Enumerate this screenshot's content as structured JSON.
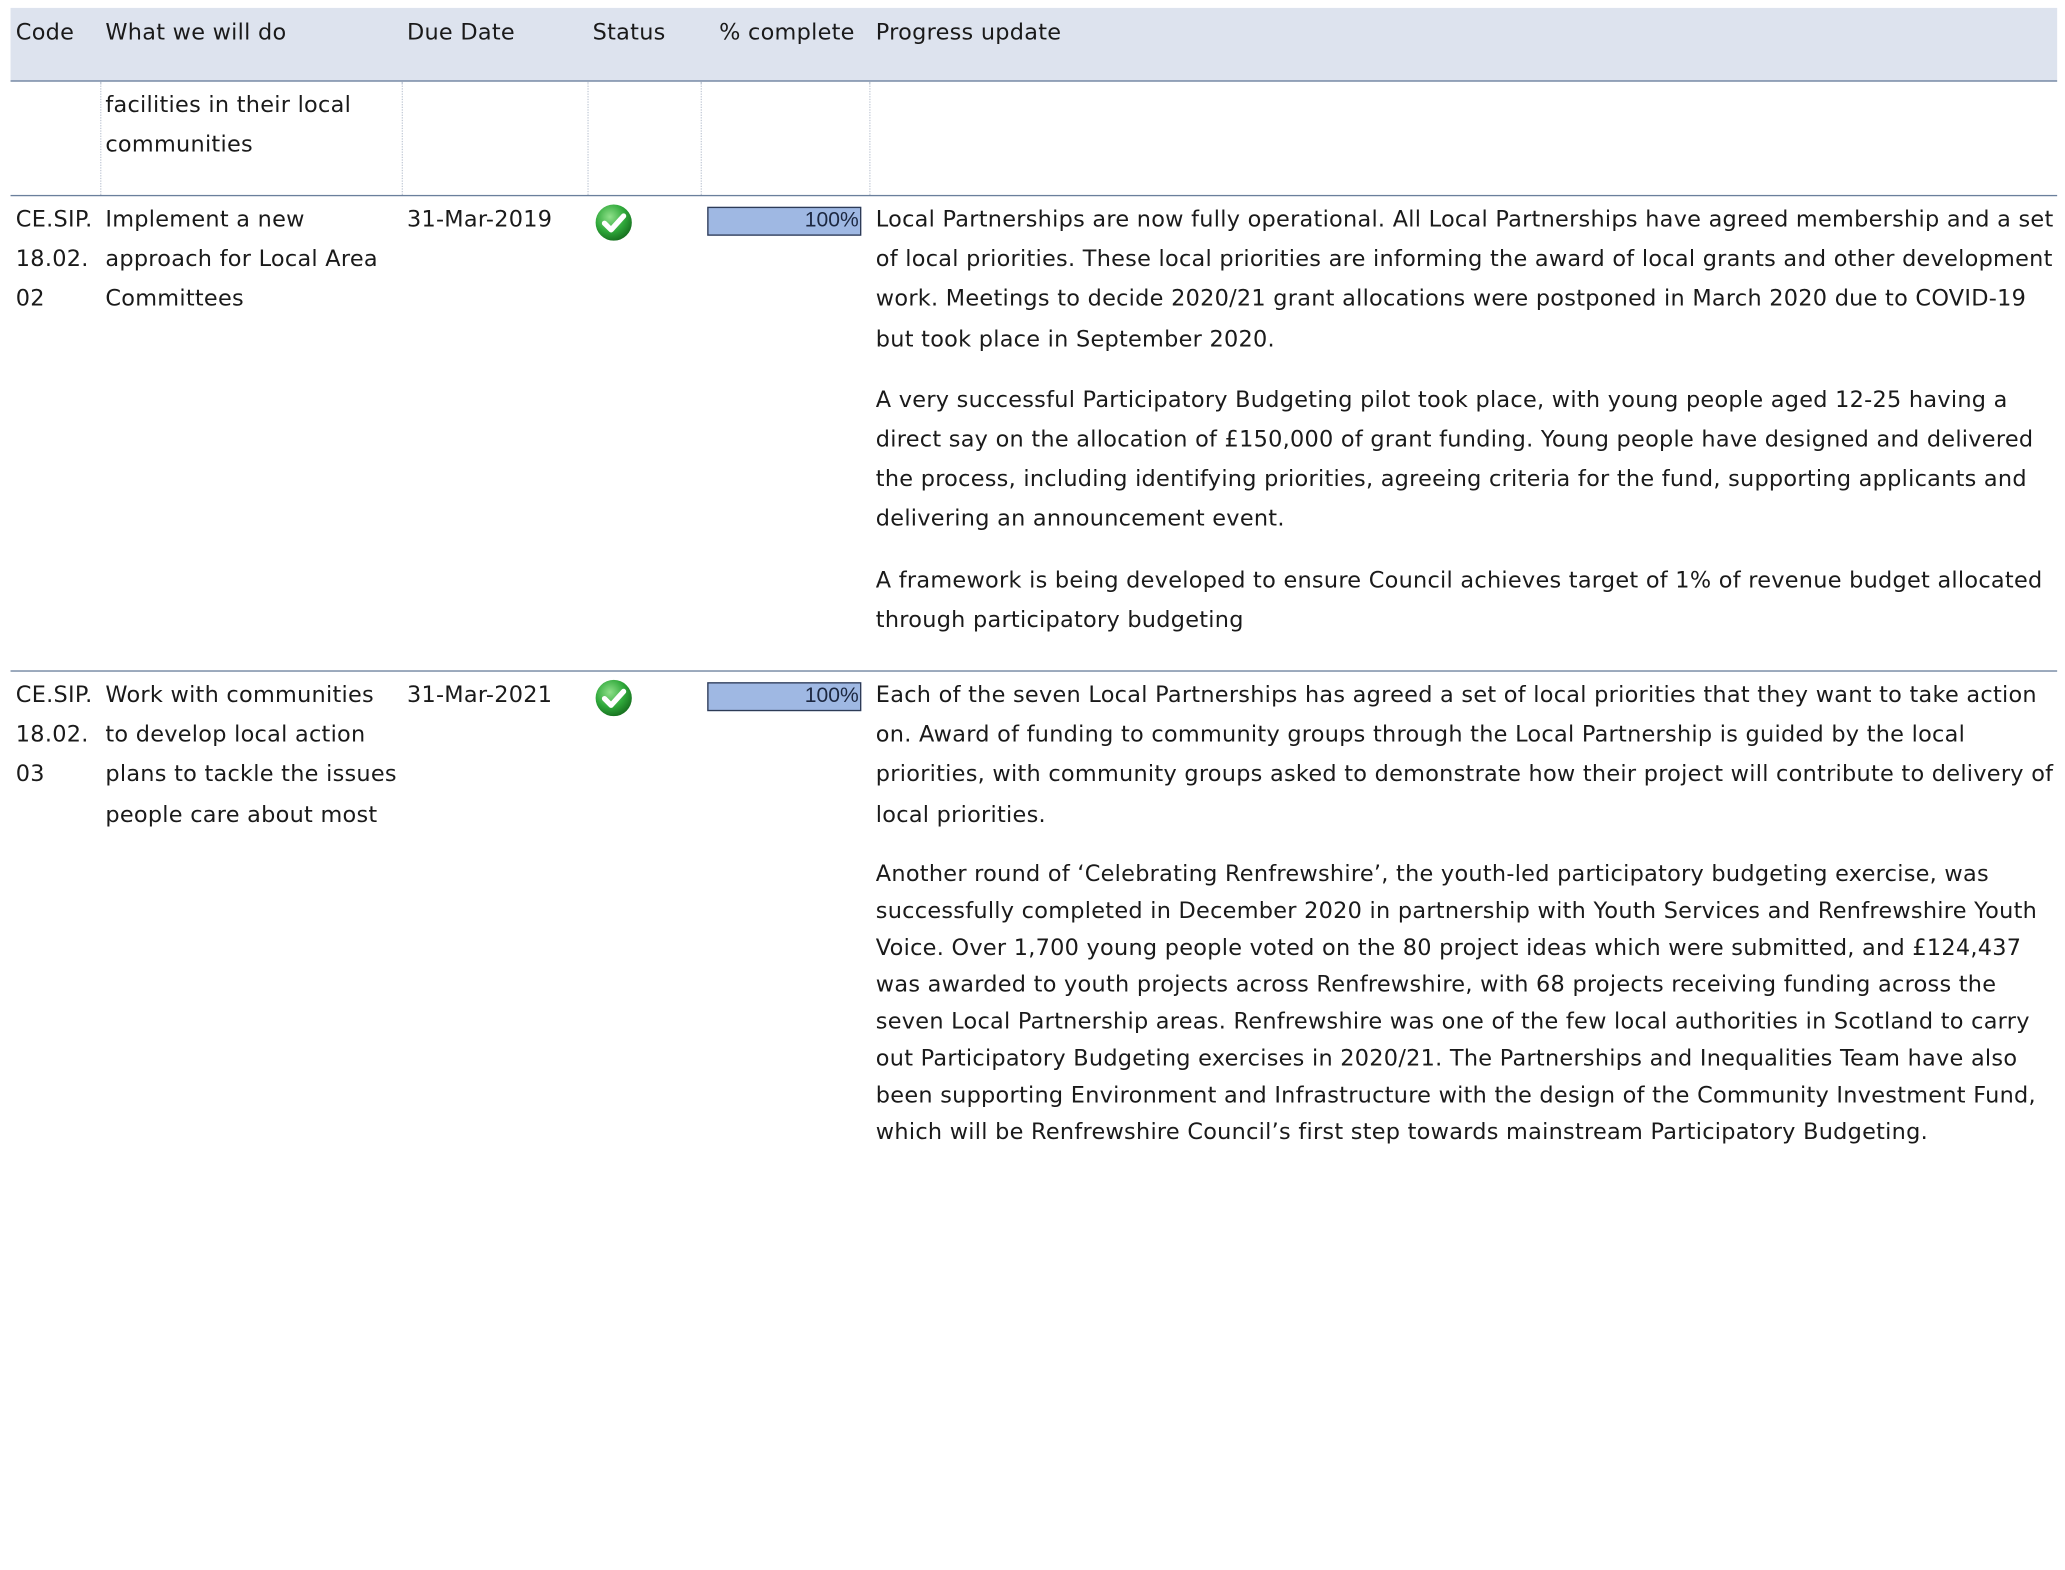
{
  "table": {
    "headers": {
      "code": "Code",
      "what": "What we will do",
      "due": "Due Date",
      "status": "Status",
      "pct": "% complete",
      "progress": "Progress update"
    },
    "continuation": {
      "what": [
        "facilities in their local",
        "communities"
      ]
    },
    "rows": [
      {
        "code": "CE.SIP.18.02.02",
        "what": "Implement a new approach for Local Area Committees",
        "due": "31-Mar-2019",
        "status_icon": "green-check-circle-icon",
        "pct_value": 100,
        "pct_label": "100%",
        "progress": [
          "Local Partnerships are now fully operational. All Local Partnerships have agreed membership and a set of local priorities. These local priorities are informing the award of local grants and other development work. Meetings to decide 2020/21 grant allocations were postponed in March 2020 due to COVID-19 but took place in September 2020.",
          "A very successful Participatory Budgeting pilot took place, with young people aged 12-25 having a direct say on the allocation of £150,000 of grant funding. Young people have designed and delivered the process, including identifying priorities, agreeing criteria for the fund, supporting applicants and delivering an announcement event.",
          "A framework is being developed to ensure Council achieves target of 1% of revenue budget allocated through participatory budgeting"
        ]
      },
      {
        "code": "CE.SIP.18.02.03",
        "what": "Work with communities to develop local action plans to tackle the issues people care about most",
        "due": "31-Mar-2021",
        "status_icon": "green-check-circle-icon",
        "pct_value": 100,
        "pct_label": "100%",
        "progress": [
          "Each of the seven Local Partnerships has agreed a set of local priorities that they want to take action on. Award of funding to community groups through the Local Partnership is guided by the local priorities, with community groups asked to demonstrate how their project will contribute to delivery of local priorities.",
          "Another round of ‘Celebrating Renfrewshire’, the youth-led participatory budgeting exercise, was successfully completed in December 2020 in partnership with Youth Services and Renfrewshire Youth Voice. Over 1,700 young people voted on the 80 project ideas which were submitted, and £124,437 was awarded to youth projects across Renfrewshire, with 68 projects receiving funding across the seven Local Partnership areas. Renfrewshire was one of the few local authorities in Scotland to carry out Participatory Budgeting exercises in 2020/21. The Partnerships and Inequalities Team have also been supporting Environment and Infrastructure with the design of the Community Investment Fund, which will be Renfrewshire Council’s first step towards mainstream Participatory Budgeting."
        ]
      }
    ]
  },
  "colors": {
    "header_bg": "#dde3ee",
    "rule": "#6a7f9c",
    "bar_fill": "#9fb8e3",
    "status_green": "#2fa83a"
  }
}
